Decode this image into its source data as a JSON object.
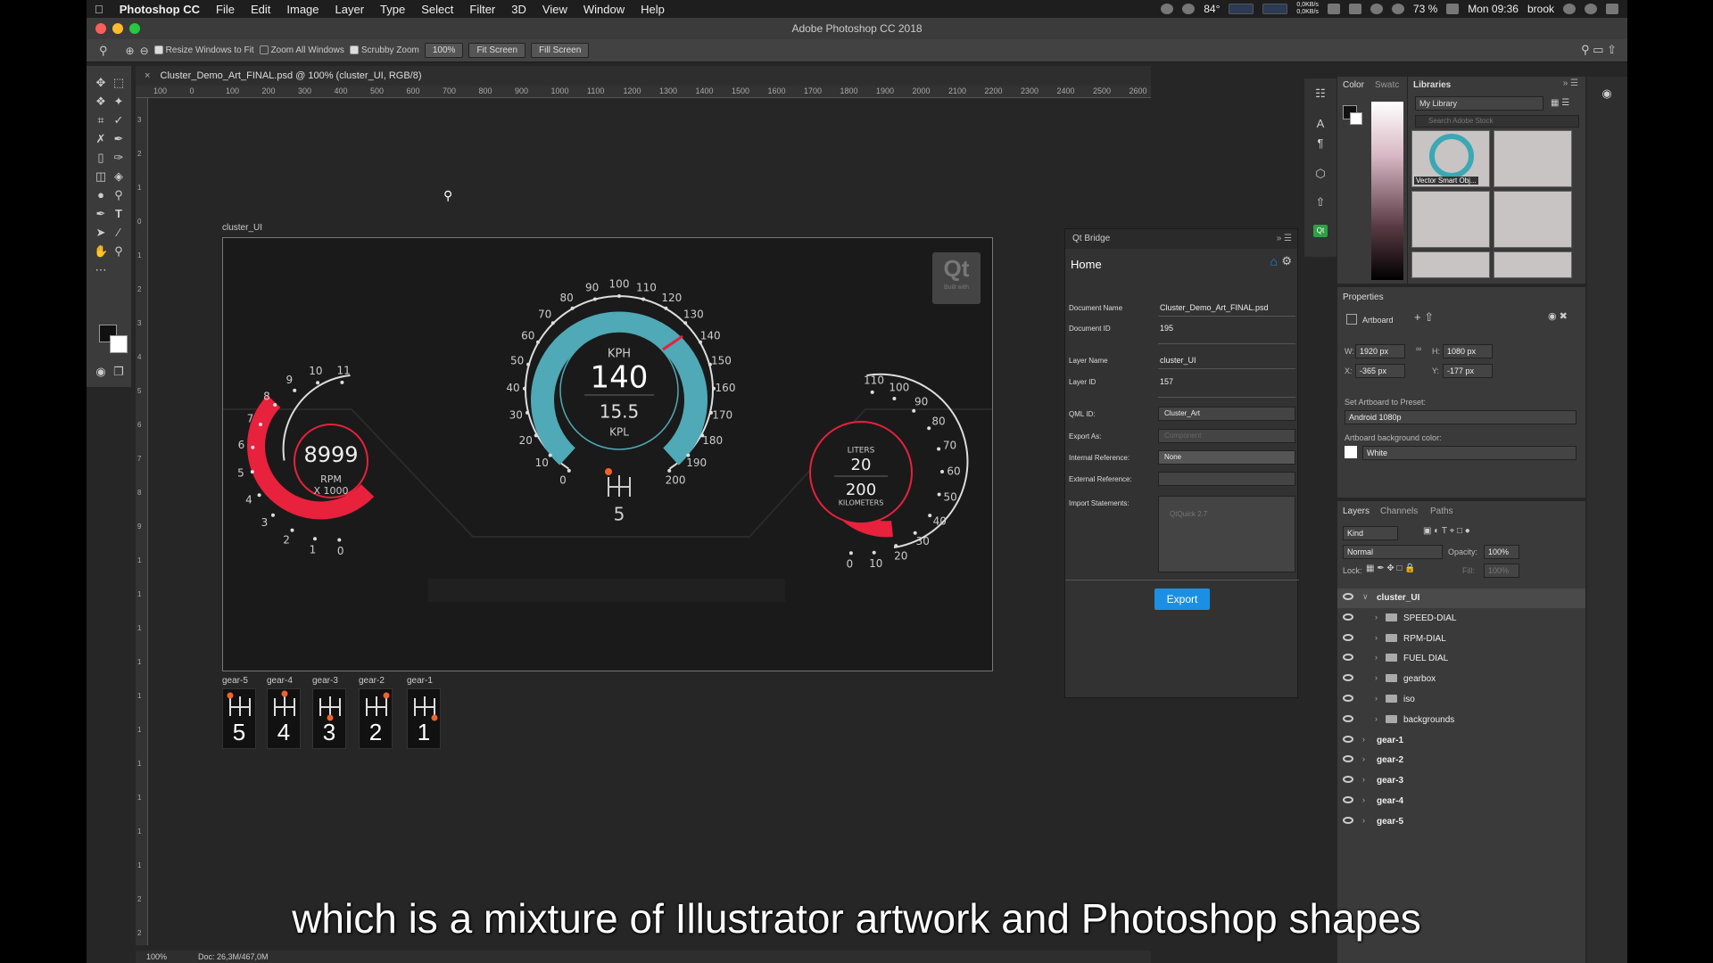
{
  "menubar": {
    "app_name": "Photoshop CC",
    "items": [
      "File",
      "Edit",
      "Image",
      "Layer",
      "Type",
      "Select",
      "Filter",
      "3D",
      "View",
      "Window",
      "Help"
    ],
    "temperature": "84°",
    "net_up": "0,0KB/s",
    "net_down": "0,0KB/s",
    "battery": "73 %",
    "clock": "Mon 09:36",
    "user": "brook"
  },
  "window_title": "Adobe Photoshop CC 2018",
  "options_bar": {
    "resize_windows": "Resize Windows to Fit",
    "zoom_all": "Zoom All Windows",
    "scrubby_zoom": "Scrubby Zoom",
    "zoom_value": "100%",
    "fit_screen": "Fit Screen",
    "fill_screen": "Fill Screen"
  },
  "document_tab": "Cluster_Demo_Art_FINAL.psd @ 100% (cluster_UI, RGB/8)",
  "ruler_top": [
    "100",
    "0",
    "100",
    "200",
    "300",
    "400",
    "500",
    "600",
    "700",
    "800",
    "900",
    "1000",
    "1100",
    "1200",
    "1300",
    "1400",
    "1500",
    "1600",
    "1700",
    "1800",
    "1900",
    "2000",
    "2100",
    "2200",
    "2300",
    "2400",
    "2500",
    "2600"
  ],
  "ruler_left": [
    "3",
    "2",
    "1",
    "0",
    "1",
    "2",
    "3",
    "4",
    "5",
    "6",
    "7",
    "8",
    "9",
    "1",
    "1",
    "1",
    "1",
    "1",
    "1",
    "1",
    "1",
    "1",
    "1",
    "2",
    "2"
  ],
  "artboard": {
    "name": "cluster_UI",
    "qt_logo": "Qt",
    "qt_built_with": "Built with",
    "speed_unit": "KPH",
    "speed_value": "140",
    "economy_value": "15.5",
    "economy_unit": "KPL",
    "gear_current": "5",
    "speed_ticks": [
      "0",
      "10",
      "20",
      "30",
      "40",
      "50",
      "60",
      "70",
      "80",
      "90",
      "100",
      "110",
      "120",
      "130",
      "140",
      "150",
      "160",
      "170",
      "180",
      "190",
      "200"
    ],
    "rpm_value": "8999",
    "rpm_unit": "RPM",
    "rpm_multiplier": "X 1000",
    "rpm_ticks": [
      "0",
      "1",
      "2",
      "3",
      "4",
      "5",
      "6",
      "7",
      "8",
      "9",
      "10",
      "11"
    ],
    "fuel_unit": "LITERS",
    "fuel_value": "20",
    "range_value": "200",
    "range_unit": "KILOMETERS",
    "fuel_ticks": [
      "0",
      "10",
      "20",
      "30",
      "40",
      "50",
      "60",
      "70",
      "80",
      "90",
      "100",
      "110"
    ]
  },
  "gears": [
    {
      "label": "gear-5",
      "number": "5"
    },
    {
      "label": "gear-4",
      "number": "4"
    },
    {
      "label": "gear-3",
      "number": "3"
    },
    {
      "label": "gear-2",
      "number": "2"
    },
    {
      "label": "gear-1",
      "number": "1"
    }
  ],
  "qt_bridge": {
    "title": "Qt Bridge",
    "home": "Home",
    "document_name_label": "Document Name",
    "document_name": "Cluster_Demo_Art_FINAL.psd",
    "document_id_label": "Document ID",
    "document_id": "195",
    "layer_name_label": "Layer Name",
    "layer_name": "cluster_UI",
    "layer_id_label": "Layer ID",
    "layer_id": "157",
    "qml_id_label": "QML ID:",
    "qml_id": "Cluster_Art",
    "export_as_label": "Export As:",
    "export_as": "Component",
    "internal_ref_label": "Internal Reference:",
    "internal_ref": "None",
    "external_ref_label": "External Reference:",
    "import_label": "Import Statements:",
    "import_placeholder": "QtQuick 2.7",
    "export_button": "Export"
  },
  "color_panel": {
    "tab_color": "Color",
    "tab_swatches": "Swatc"
  },
  "libraries": {
    "title": "Libraries",
    "library": "My Library",
    "search_placeholder": "Search Adobe Stock",
    "thumb_caption": "Vector Smart Obj..."
  },
  "properties": {
    "title": "Properties",
    "artboard": "Artboard",
    "w_label": "W:",
    "w_value": "1920 px",
    "h_label": "H:",
    "h_value": "1080 px",
    "x_label": "X:",
    "x_value": "-365 px",
    "y_label": "Y:",
    "y_value": "-177 px",
    "preset_label": "Set Artboard to Preset:",
    "preset_value": "Android 1080p",
    "bg_label": "Artboard background color:",
    "bg_value": "White"
  },
  "layers_panel": {
    "tabs": [
      "Layers",
      "Channels",
      "Paths"
    ],
    "kind": "Kind",
    "blend": "Normal",
    "opacity_label": "Opacity:",
    "opacity": "100%",
    "lock_label": "Lock:",
    "fill_label": "Fill:",
    "fill": "100%",
    "layers": [
      {
        "name": "cluster_UI",
        "level": 0,
        "folder": false
      },
      {
        "name": "SPEED-DIAL",
        "level": 1,
        "folder": true
      },
      {
        "name": "RPM-DIAL",
        "level": 1,
        "folder": true
      },
      {
        "name": "FUEL DIAL",
        "level": 1,
        "folder": true
      },
      {
        "name": "gearbox",
        "level": 1,
        "folder": true
      },
      {
        "name": "iso",
        "level": 1,
        "folder": true
      },
      {
        "name": "backgrounds",
        "level": 1,
        "folder": true
      },
      {
        "name": "gear-1",
        "level": 0,
        "folder": false
      },
      {
        "name": "gear-2",
        "level": 0,
        "folder": false
      },
      {
        "name": "gear-3",
        "level": 0,
        "folder": false
      },
      {
        "name": "gear-4",
        "level": 0,
        "folder": false
      },
      {
        "name": "gear-5",
        "level": 0,
        "folder": false
      }
    ]
  },
  "status_bar": {
    "zoom": "100%",
    "doc": "Doc: 26,3M/467,0M"
  },
  "subtitle": "which is a mixture of Illustrator artwork and Photoshop shapes",
  "colors": {
    "accent_teal": "#4fa9b6",
    "accent_red": "#e8213c",
    "export_blue": "#1a8fe3"
  }
}
